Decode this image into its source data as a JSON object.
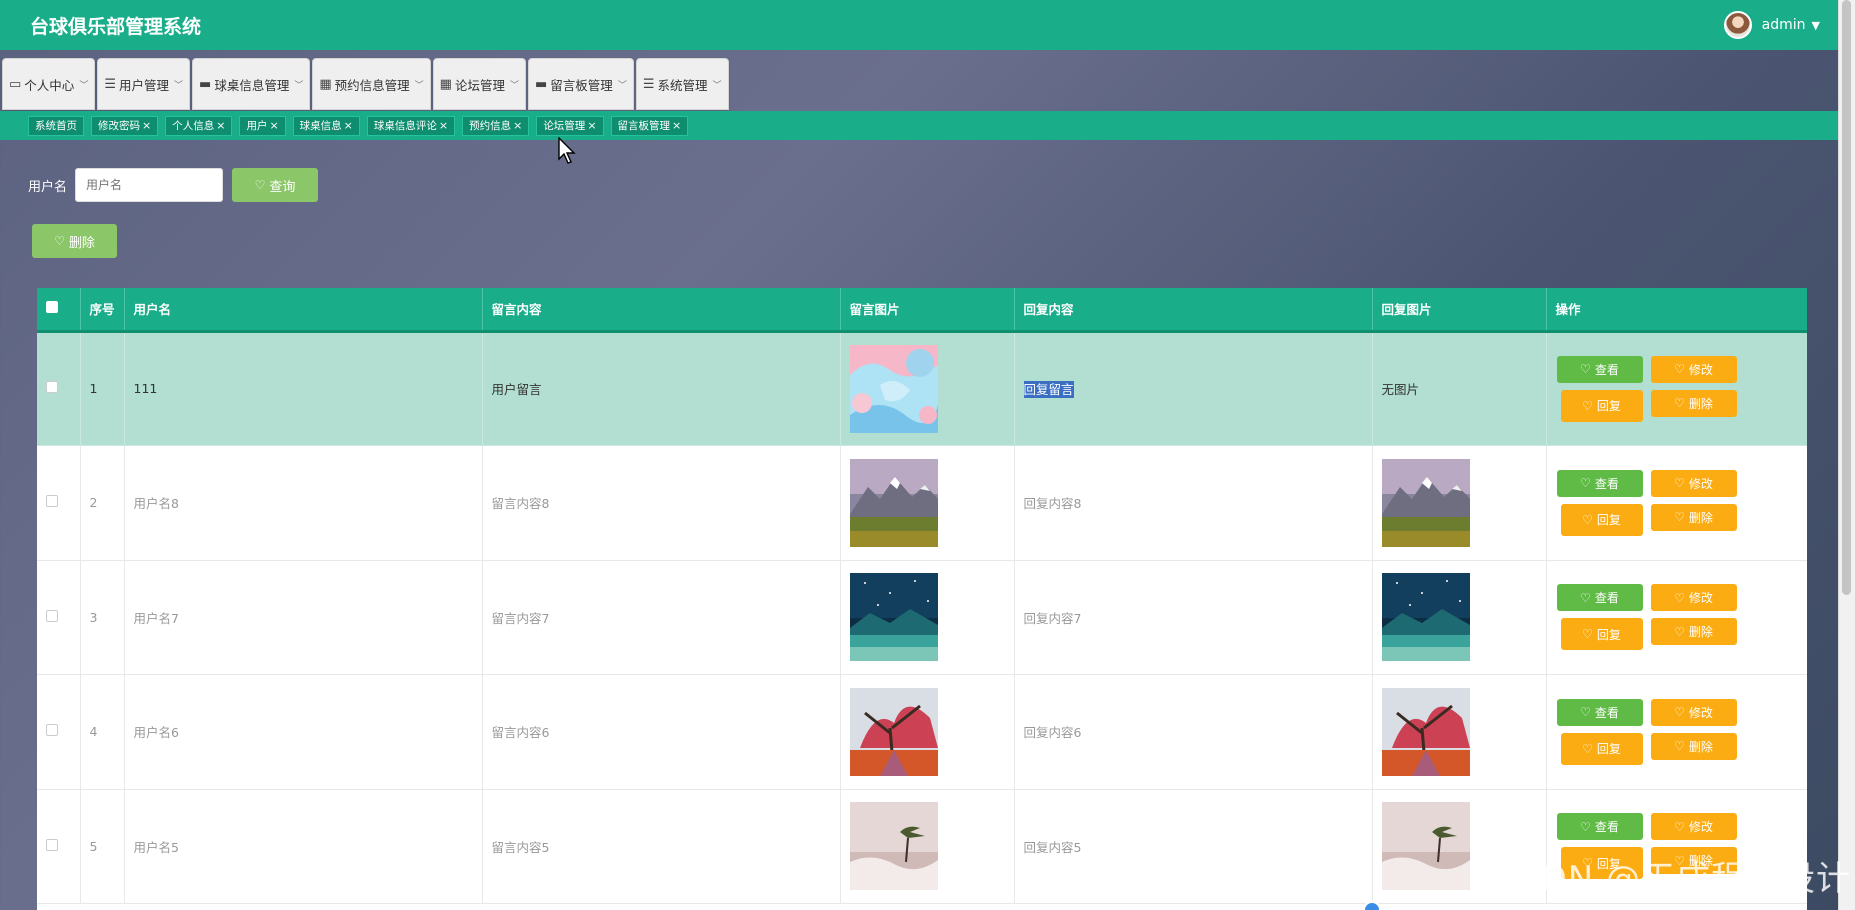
{
  "header": {
    "title": "台球俱乐部管理系统",
    "user": "admin"
  },
  "menu": [
    {
      "label": "个人中心",
      "icon": "calendar-icon"
    },
    {
      "label": "用户管理",
      "icon": "list-icon"
    },
    {
      "label": "球桌信息管理",
      "icon": "monitor-icon"
    },
    {
      "label": "预约信息管理",
      "icon": "grid-icon"
    },
    {
      "label": "论坛管理",
      "icon": "grid-icon"
    },
    {
      "label": "留言板管理",
      "icon": "monitor-icon"
    },
    {
      "label": "系统管理",
      "icon": "list-icon"
    }
  ],
  "tags": [
    {
      "label": "系统首页",
      "closable": false
    },
    {
      "label": "修改密码",
      "closable": true
    },
    {
      "label": "个人信息",
      "closable": true
    },
    {
      "label": "用户",
      "closable": true
    },
    {
      "label": "球桌信息",
      "closable": true
    },
    {
      "label": "球桌信息评论",
      "closable": true
    },
    {
      "label": "预约信息",
      "closable": true
    },
    {
      "label": "论坛管理",
      "closable": true
    },
    {
      "label": "留言板管理",
      "closable": true
    }
  ],
  "search": {
    "label": "用户名",
    "placeholder": "用户名",
    "button": "查询"
  },
  "toolbar": {
    "delete": "删除"
  },
  "table": {
    "columns": [
      "序号",
      "用户名",
      "留言内容",
      "留言图片",
      "回复内容",
      "回复图片",
      "操作"
    ],
    "rows": [
      {
        "index": "1",
        "username": "111",
        "content": "用户留言",
        "reply": "回复留言",
        "reply_image_text": "无图片",
        "selected": true,
        "image": "abstract",
        "reply_image": ""
      },
      {
        "index": "2",
        "username": "用户名8",
        "content": "留言内容8",
        "reply": "回复内容8",
        "reply_image_text": "",
        "selected": false,
        "image": "mountain",
        "reply_image": "mountain"
      },
      {
        "index": "3",
        "username": "用户名7",
        "content": "留言内容7",
        "reply": "回复内容7",
        "reply_image_text": "",
        "selected": false,
        "image": "night",
        "reply_image": "night"
      },
      {
        "index": "4",
        "username": "用户名6",
        "content": "留言内容6",
        "reply": "回复内容6",
        "reply_image_text": "",
        "selected": false,
        "image": "autumn",
        "reply_image": "autumn"
      },
      {
        "index": "5",
        "username": "用户名5",
        "content": "留言内容5",
        "reply": "回复内容5",
        "reply_image_text": "",
        "selected": false,
        "image": "fog",
        "reply_image": "fog"
      }
    ],
    "actions": {
      "view": "查看",
      "edit": "修改",
      "reply": "回复",
      "delete": "删除"
    }
  },
  "watermark": "CSDN @天成程序设计",
  "colors": {
    "primary": "#19ad8a",
    "success": "#5fba46",
    "warning": "#fbac13",
    "soft_green": "#8bc768"
  }
}
